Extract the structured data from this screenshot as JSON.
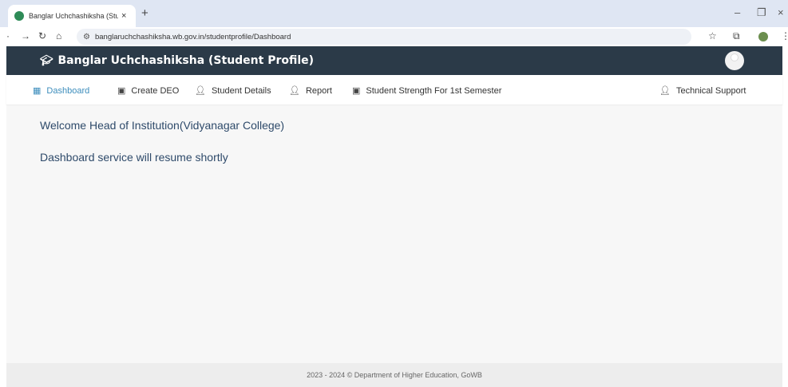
{
  "browser": {
    "tab_title": "Banglar Uchchashiksha (Studen",
    "tab_close": "×",
    "new_tab": "+",
    "url": "banglaruchchashiksha.wb.gov.in/studentprofile/Dashboard",
    "icons": [
      "back-icon",
      "forward-icon",
      "reload-icon",
      "home-icon",
      "site-info-icon",
      "star-icon",
      "extensions-icon",
      "profile-icon",
      "menu-icon"
    ]
  },
  "header": {
    "brand": "Banglar Uchchashiksha (Student Profile)",
    "brand_icon": "graduation-cap-icon",
    "background": "#2b3a48"
  },
  "nav": {
    "items": [
      {
        "label": "Dashboard",
        "icon": "dashboard-icon",
        "active": true
      },
      {
        "label": "Create DEO",
        "icon": "form-icon"
      },
      {
        "label": "Student Details",
        "icon": "user-icon"
      },
      {
        "label": "Report",
        "icon": "user-icon"
      },
      {
        "label": "Student Strength For 1st Semester",
        "icon": "form-icon"
      },
      {
        "label": "Technical Support",
        "icon": "user-icon"
      }
    ],
    "active_color": "#3c8dbc"
  },
  "content": {
    "welcome": "Welcome Head of Institution(Vidyanagar College)",
    "notice": "Dashboard service will resume shortly"
  },
  "footer": {
    "text": "2023 - 2024 © Department of Higher Education, GoWB"
  }
}
